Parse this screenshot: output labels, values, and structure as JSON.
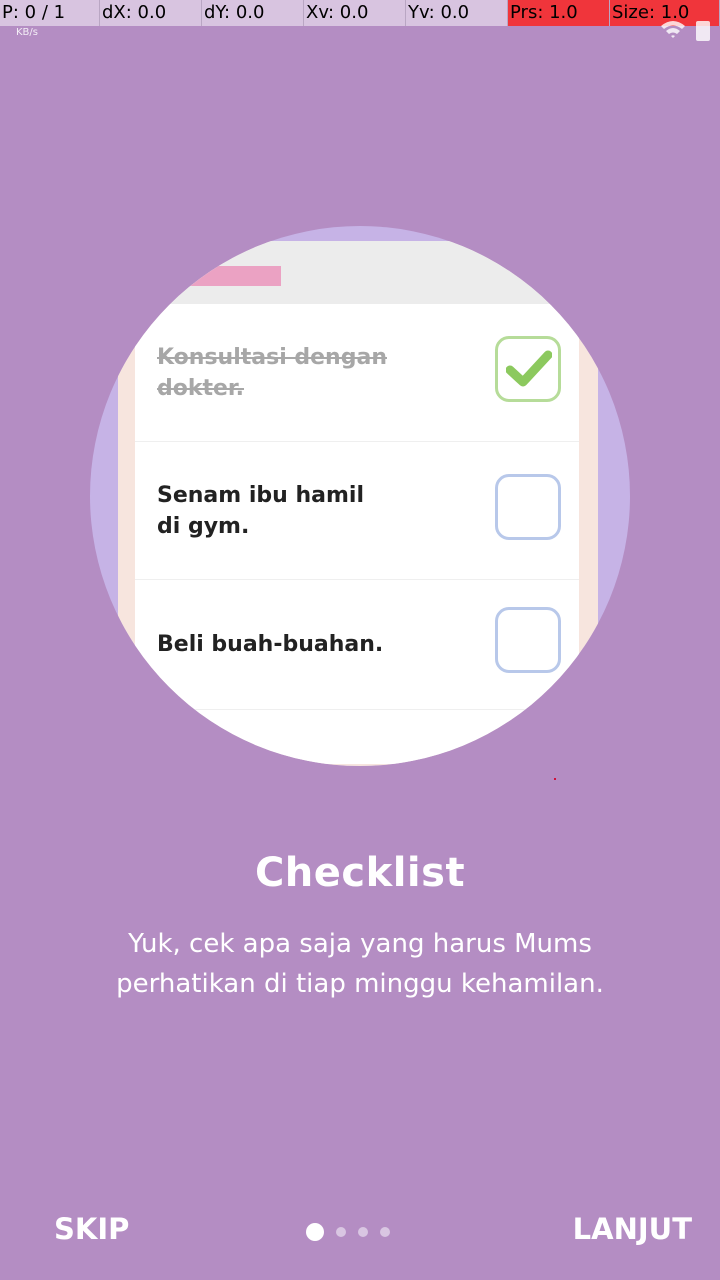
{
  "debug": {
    "p": "P: 0 / 1",
    "dx": "dX: 0.0",
    "dy": "dY: 0.0",
    "xv": "Xv: 0.0",
    "yv": "Yv: 0.0",
    "prs": "Prs: 1.0",
    "size": "Size: 1.0"
  },
  "status_bar": {
    "speed_unit": "KB/s"
  },
  "checklist_items": [
    {
      "label": "Konsultasi dengan dokter.",
      "checked": true
    },
    {
      "label": "Senam ibu hamil di gym.",
      "checked": false
    },
    {
      "label": "Beli buah-buahan.",
      "checked": false
    }
  ],
  "onboarding": {
    "title": "Checklist",
    "description": "Yuk, cek apa saja yang harus Mums perhatikan di tiap minggu kehamilan."
  },
  "footer": {
    "skip_label": "SKIP",
    "next_label": "LANJUT",
    "pages": 4,
    "active_page": 1
  },
  "colors": {
    "background": "#b48dc3",
    "circle": "#c6b3e6",
    "check_green": "#8cc95e",
    "accent_pink": "#eba2c3"
  }
}
